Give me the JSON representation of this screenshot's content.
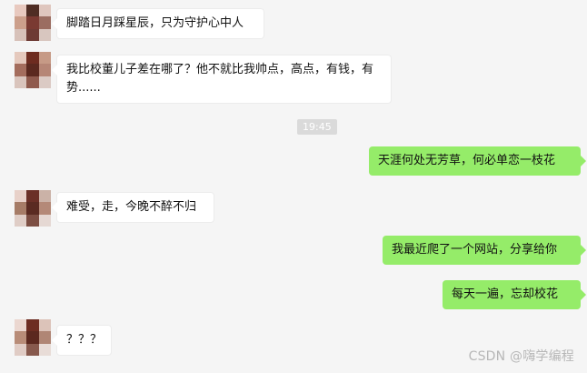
{
  "messages": [
    {
      "sender": "friend",
      "text": "脚踏日月踩星辰，只为守护心中人"
    },
    {
      "sender": "friend",
      "text": "我比校董儿子差在哪了？他不就比我帅点，高点，有钱，有势......"
    },
    {
      "sender": "me",
      "text": "天涯何处无芳草，何必单恋一枝花"
    },
    {
      "sender": "friend",
      "text": "难受，走，今晚不醉不归"
    },
    {
      "sender": "me",
      "text": "我最近爬了一个网站，分享给你"
    },
    {
      "sender": "me",
      "text": "每天一遍，忘却校花"
    },
    {
      "sender": "friend",
      "text": "？？？"
    }
  ],
  "time_separator": "19:45",
  "watermark": "CSDN @嗨学编程",
  "colors": {
    "background": "#f5f5f5",
    "incoming_bubble": "#ffffff",
    "outgoing_bubble": "#95ec69",
    "timestamp_badge": "#dadada",
    "watermark": "#b7b7b7"
  },
  "icons": {
    "friend_avatar": "pixelated-avatar-icon"
  }
}
